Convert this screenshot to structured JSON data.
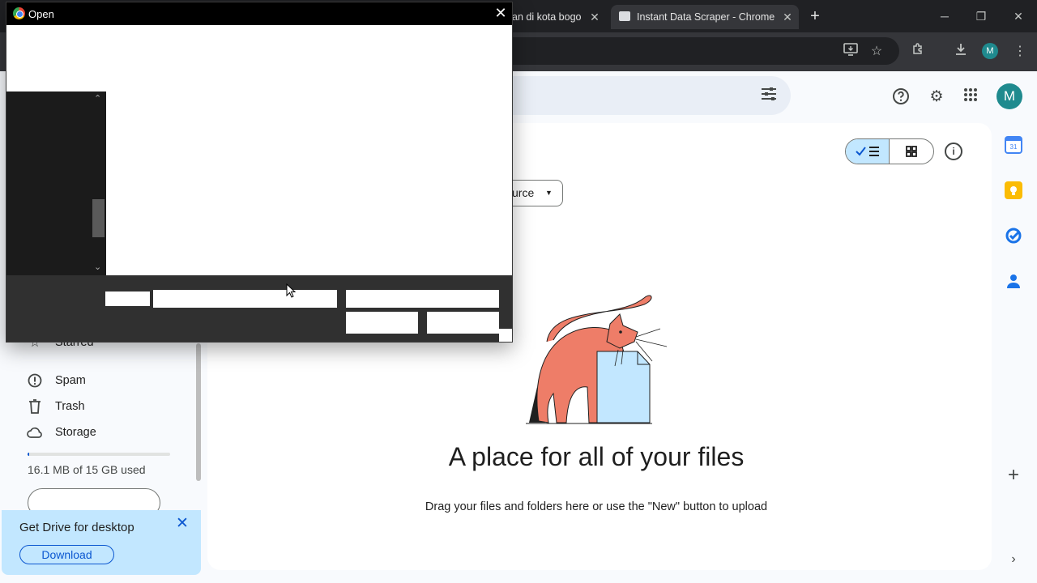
{
  "browser": {
    "tabs": [
      {
        "title": "an di kota bogo",
        "close": "✕"
      },
      {
        "title": "Instant Data Scraper - Chrome",
        "close": "✕"
      }
    ],
    "new_tab": "+",
    "window_controls": {
      "minimize": "─",
      "maximize": "❐",
      "close": "✕"
    },
    "profile_initial": "M"
  },
  "drive": {
    "user_initial": "M",
    "source_chip": "urce",
    "empty_title": "A place for all of your files",
    "empty_subtitle": "Drag your files and folders here or use the \"New\" button to upload",
    "nav": {
      "starred": "Starred",
      "spam": "Spam",
      "trash": "Trash",
      "storage": "Storage"
    },
    "storage": {
      "used_text": "16.1 MB of 15 GB used",
      "used_fraction": 0.001
    },
    "promo": {
      "title": "Get Drive for desktop",
      "download": "Download"
    }
  },
  "dialog": {
    "title": "Open",
    "close": "✕"
  },
  "colors": {
    "accent": "#0b57d0",
    "selected_toggle": "#c2e7ff",
    "avatar": "#1f8a8e",
    "cat": "#ee7d68",
    "paper": "#c2e7ff"
  }
}
